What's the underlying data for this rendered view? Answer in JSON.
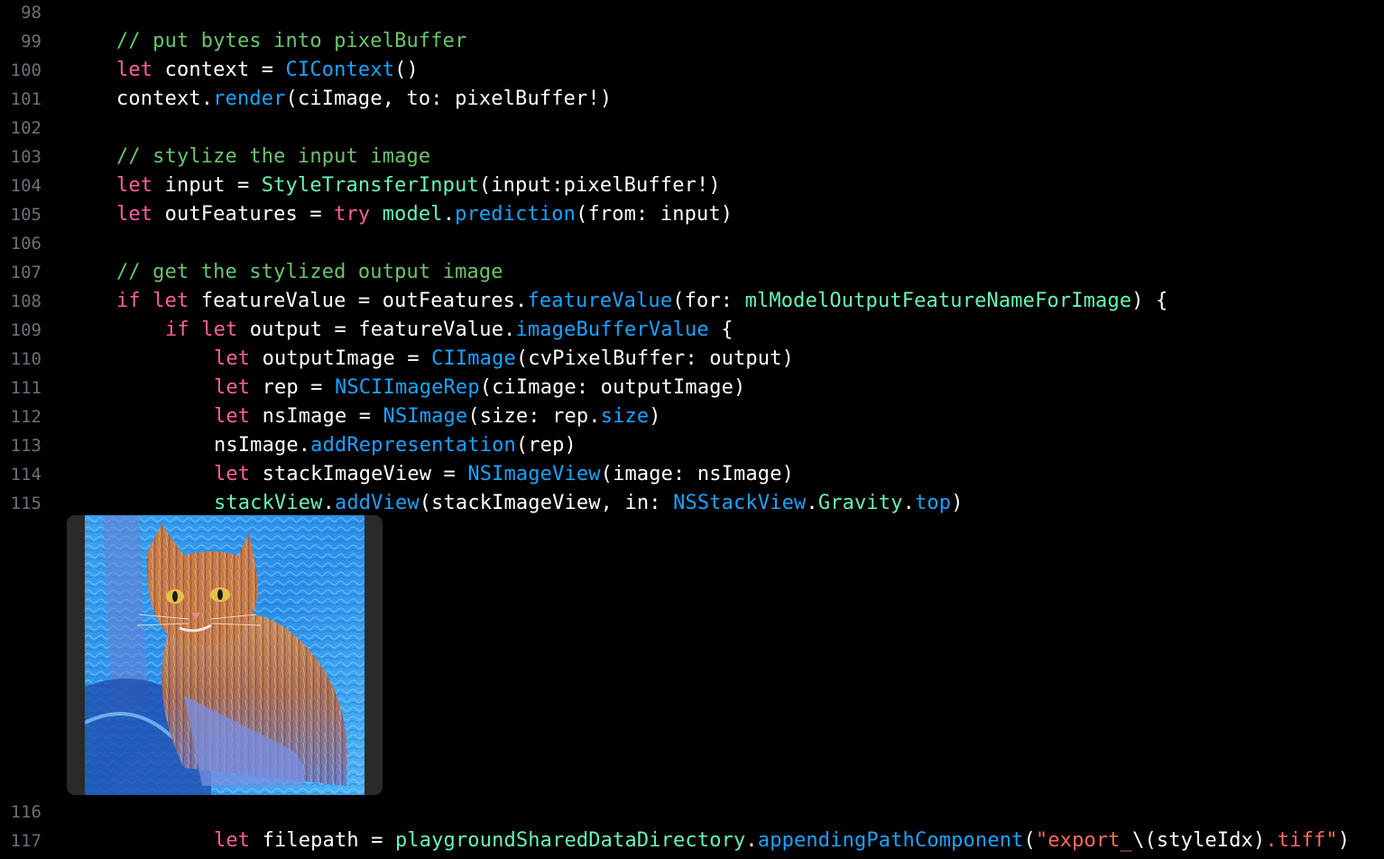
{
  "editor": {
    "lines": [
      {
        "num": "98",
        "indent": 0,
        "tokens": []
      },
      {
        "num": "99",
        "indent": 0,
        "tokens": [
          {
            "t": "// put bytes into pixelBuffer",
            "k": "cm"
          }
        ]
      },
      {
        "num": "100",
        "indent": 0,
        "tokens": [
          {
            "t": "let",
            "k": "kw"
          },
          {
            "t": " context = ",
            "k": "tx"
          },
          {
            "t": "CIContext",
            "k": "ty"
          },
          {
            "t": "()",
            "k": "tx"
          }
        ]
      },
      {
        "num": "101",
        "indent": 0,
        "tokens": [
          {
            "t": "context.",
            "k": "tx"
          },
          {
            "t": "render",
            "k": "fn"
          },
          {
            "t": "(ciImage, to: pixelBuffer!)",
            "k": "tx"
          }
        ]
      },
      {
        "num": "102",
        "indent": 0,
        "tokens": []
      },
      {
        "num": "103",
        "indent": 0,
        "tokens": [
          {
            "t": "// stylize the input image",
            "k": "cm"
          }
        ]
      },
      {
        "num": "104",
        "indent": 0,
        "tokens": [
          {
            "t": "let",
            "k": "kw"
          },
          {
            "t": " input = ",
            "k": "tx"
          },
          {
            "t": "StyleTransferInput",
            "k": "pl"
          },
          {
            "t": "(input:pixelBuffer!)",
            "k": "tx"
          }
        ]
      },
      {
        "num": "105",
        "indent": 0,
        "tokens": [
          {
            "t": "let",
            "k": "kw"
          },
          {
            "t": " outFeatures = ",
            "k": "tx"
          },
          {
            "t": "try",
            "k": "kw"
          },
          {
            "t": " ",
            "k": "tx"
          },
          {
            "t": "model",
            "k": "pl"
          },
          {
            "t": ".",
            "k": "tx"
          },
          {
            "t": "prediction",
            "k": "fn"
          },
          {
            "t": "(from: input)",
            "k": "tx"
          }
        ]
      },
      {
        "num": "106",
        "indent": 0,
        "tokens": []
      },
      {
        "num": "107",
        "indent": 0,
        "tokens": [
          {
            "t": "// get the stylized output image",
            "k": "cm"
          }
        ]
      },
      {
        "num": "108",
        "indent": 0,
        "tokens": [
          {
            "t": "if",
            "k": "kw"
          },
          {
            "t": " ",
            "k": "tx"
          },
          {
            "t": "let",
            "k": "kw"
          },
          {
            "t": " featureValue = outFeatures.",
            "k": "tx"
          },
          {
            "t": "featureValue",
            "k": "fn"
          },
          {
            "t": "(for: ",
            "k": "tx"
          },
          {
            "t": "mlModelOutputFeatureNameForImage",
            "k": "pl"
          },
          {
            "t": ") {",
            "k": "tx"
          }
        ]
      },
      {
        "num": "109",
        "indent": 1,
        "tokens": [
          {
            "t": "if",
            "k": "kw"
          },
          {
            "t": " ",
            "k": "tx"
          },
          {
            "t": "let",
            "k": "kw"
          },
          {
            "t": " output = featureValue.",
            "k": "tx"
          },
          {
            "t": "imageBufferValue",
            "k": "fn"
          },
          {
            "t": " {",
            "k": "tx"
          }
        ]
      },
      {
        "num": "110",
        "indent": 2,
        "tokens": [
          {
            "t": "let",
            "k": "kw"
          },
          {
            "t": " outputImage = ",
            "k": "tx"
          },
          {
            "t": "CIImage",
            "k": "ty"
          },
          {
            "t": "(cvPixelBuffer: output)",
            "k": "tx"
          }
        ]
      },
      {
        "num": "111",
        "indent": 2,
        "tokens": [
          {
            "t": "let",
            "k": "kw"
          },
          {
            "t": " rep = ",
            "k": "tx"
          },
          {
            "t": "NSCIImageRep",
            "k": "ty"
          },
          {
            "t": "(ciImage: outputImage)",
            "k": "tx"
          }
        ]
      },
      {
        "num": "112",
        "indent": 2,
        "tokens": [
          {
            "t": "let",
            "k": "kw"
          },
          {
            "t": " nsImage = ",
            "k": "tx"
          },
          {
            "t": "NSImage",
            "k": "ty"
          },
          {
            "t": "(size: rep.",
            "k": "tx"
          },
          {
            "t": "size",
            "k": "fn"
          },
          {
            "t": ")",
            "k": "tx"
          }
        ]
      },
      {
        "num": "113",
        "indent": 2,
        "tokens": [
          {
            "t": "nsImage.",
            "k": "tx"
          },
          {
            "t": "addRepresentation",
            "k": "fn"
          },
          {
            "t": "(rep)",
            "k": "tx"
          }
        ]
      },
      {
        "num": "114",
        "indent": 2,
        "tokens": [
          {
            "t": "let",
            "k": "kw"
          },
          {
            "t": " stackImageView = ",
            "k": "tx"
          },
          {
            "t": "NSImageView",
            "k": "ty"
          },
          {
            "t": "(image: nsImage)",
            "k": "tx"
          }
        ]
      },
      {
        "num": "115",
        "indent": 2,
        "tokens": [
          {
            "t": "stackView",
            "k": "pl"
          },
          {
            "t": ".",
            "k": "tx"
          },
          {
            "t": "addView",
            "k": "fn"
          },
          {
            "t": "(stackImageView, in: ",
            "k": "tx"
          },
          {
            "t": "NSStackView",
            "k": "ty"
          },
          {
            "t": ".",
            "k": "tx"
          },
          {
            "t": "Gravity",
            "k": "pl"
          },
          {
            "t": ".",
            "k": "tx"
          },
          {
            "t": "top",
            "k": "fn"
          },
          {
            "t": ")",
            "k": "tx"
          }
        ]
      },
      {
        "num": "116",
        "indent": 0,
        "tokens": []
      },
      {
        "num": "117",
        "indent": 2,
        "tokens": [
          {
            "t": "let",
            "k": "kw"
          },
          {
            "t": " filepath = ",
            "k": "tx"
          },
          {
            "t": "playgroundSharedDataDirectory",
            "k": "pl"
          },
          {
            "t": ".",
            "k": "tx"
          },
          {
            "t": "appendingPathComponent",
            "k": "fn"
          },
          {
            "t": "(",
            "k": "tx"
          },
          {
            "t": "\"export_",
            "k": "st"
          },
          {
            "t": "\\(styleIdx)",
            "k": "tx"
          },
          {
            "t": ".tiff\"",
            "k": "st"
          },
          {
            "t": ")",
            "k": "tx"
          }
        ]
      }
    ]
  },
  "result_preview": {
    "icon": "stylized-cat-image"
  },
  "colors": {
    "background": "#000000",
    "keyword": "#fc5fa3",
    "comment": "#6bc46d",
    "type": "#1aa3ff",
    "project": "#67f7b4",
    "string": "#fc6a5d",
    "line_number": "#6c7079"
  }
}
